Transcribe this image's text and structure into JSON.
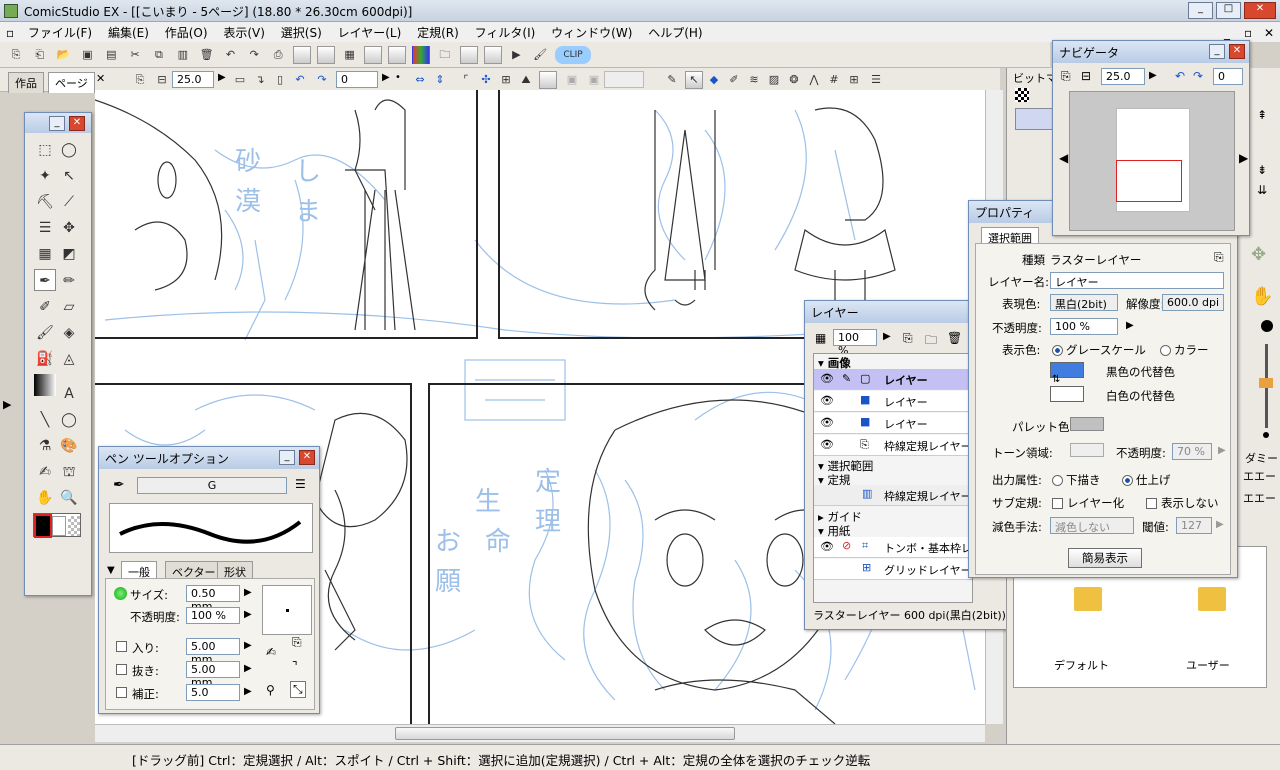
{
  "app": {
    "title": "ComicStudio EX - [[こいまり - 5ページ] (18.80 * 26.30cm 600dpi)]"
  },
  "menu": [
    "ファイル(F)",
    "編集(E)",
    "作品(O)",
    "表示(V)",
    "選択(S)",
    "レイヤー(L)",
    "定規(R)",
    "フィルタ(I)",
    "ウィンドウ(W)",
    "ヘルプ(H)"
  ],
  "tabs": {
    "work": "作品",
    "page": "ページ"
  },
  "toolbar2": {
    "zoom": "25.0",
    "rotate": "0"
  },
  "penopt": {
    "title": "ペン ツールオプション",
    "preset": "G",
    "tabs": [
      "一般",
      "ベクター",
      "形状"
    ],
    "size_label": "サイズ:",
    "size": "0.50 mm",
    "opacity_label": "不透明度:",
    "opacity": "100 %",
    "in_label": "入り:",
    "in": "5.00 mm",
    "out_label": "抜き:",
    "out": "5.00 mm",
    "corr_label": "補正:",
    "corr": "5.0"
  },
  "navigator": {
    "title": "ナビゲータ",
    "zoom": "25.0",
    "rotate": "0"
  },
  "layers": {
    "title": "レイヤー",
    "opacity": "100 %",
    "groups": {
      "image": "画像",
      "sel": "選択範囲",
      "ruler": "定規",
      "guide": "ガイド",
      "paper": "用紙"
    },
    "rows": [
      "レイヤー",
      "レイヤー",
      "レイヤー",
      "枠線定規レイヤー",
      "枠線定規レイヤー",
      "トンボ・基本枠レイヤー",
      "グリッドレイヤー"
    ],
    "status": "ラスターレイヤー 600 dpi(黒白(2bit))仕上げ..."
  },
  "props": {
    "title": "プロパティ",
    "tab": "選択範囲",
    "kind_label": "種類",
    "kind": "ラスターレイヤー",
    "name_label": "レイヤー名:",
    "name": "レイヤー",
    "expr_label": "表現色:",
    "expr": "黒白(2bit)",
    "res_label": "解像度:",
    "res": "600.0 dpi",
    "op_label": "不透明度:",
    "op": "100 %",
    "disp_label": "表示色:",
    "gray": "グレースケール",
    "color": "カラー",
    "black": "黒色の代替色",
    "white": "白色の代替色",
    "palette": "パレット色:",
    "tone": "トーン領域:",
    "tone_op_label": "不透明度:",
    "tone_op": "70 %",
    "out_label": "出力属性:",
    "draft": "下描き",
    "final": "仕上げ",
    "sub_label": "サブ定規:",
    "layerize": "レイヤー化",
    "hide": "表示しない",
    "reduce_label": "減色手法:",
    "reduce": "減色しない",
    "th_label": "閾値:",
    "th": "127",
    "simple": "簡易表示"
  },
  "rightpanel": {
    "bitmap": "ビットマ",
    "default": "デフォルト",
    "user": "ユーザー",
    "dummy": "ダミー",
    "ie1": "エエー",
    "ie2": "エエー"
  },
  "status": "[ドラッグ前] Ctrl：定規選択 / Alt：スポイト / Ctrl + Shift：選択に追加(定規選択) / Ctrl + Alt：定規の全体を選択のチェック逆転",
  "colors": {
    "accent": "#3f7ee0",
    "layerSel": "#c4c0f4"
  }
}
